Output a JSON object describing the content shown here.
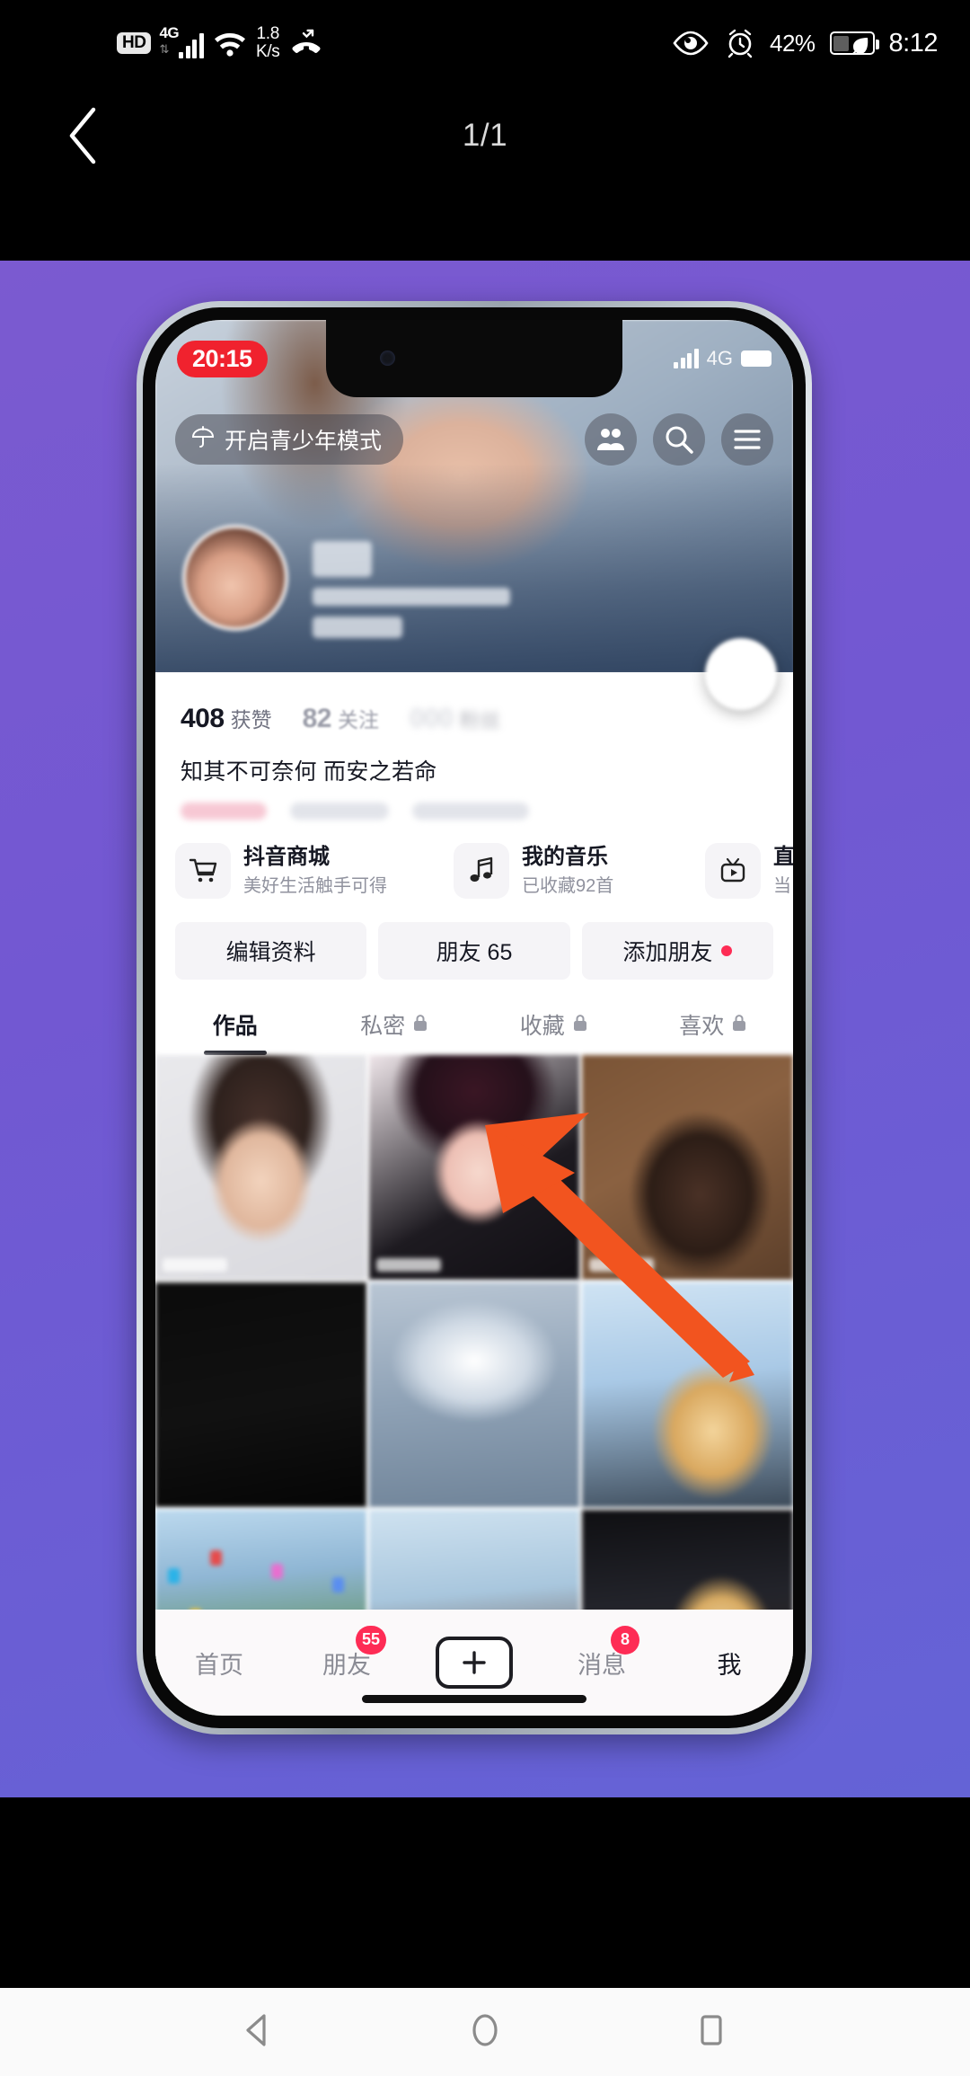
{
  "system_status_bar": {
    "hd_label": "HD",
    "network_type": "4G",
    "network_speed": "1.8",
    "network_speed_unit": "K/s",
    "battery_percent": "42%",
    "clock": "8:12",
    "icons": [
      "hd-icon",
      "signal-4g-icon",
      "wifi-icon",
      "missed-call-icon",
      "eye-comfort-icon",
      "alarm-icon",
      "battery-saver-icon"
    ]
  },
  "viewer_header": {
    "back_label": "back",
    "pager": "1/1"
  },
  "canvas": {
    "background_color": "#7258d2"
  },
  "phone_mock": {
    "app_status_bar": {
      "time": "20:15",
      "network_type": "4G"
    },
    "top_bar": {
      "teen_mode_label": "开启青少年模式",
      "icons": [
        "umbrella-icon",
        "friends-icon",
        "search-icon",
        "menu-icon"
      ]
    },
    "profile": {
      "stats": [
        {
          "number": "408",
          "label": "获赞",
          "style": "normal"
        },
        {
          "number": "82",
          "label": "关注",
          "style": "dim"
        },
        {
          "number": "",
          "label": "粉丝",
          "style": "hidden"
        }
      ],
      "bio": "知其不可奈何 而安之若命",
      "avatar_name": "avatar"
    },
    "shortcuts": [
      {
        "icon": "cart-icon",
        "title": "抖音商城",
        "subtitle": "美好生活触手可得"
      },
      {
        "icon": "music-note-icon",
        "title": "我的音乐",
        "subtitle": "已收藏92首"
      },
      {
        "icon": "tv-play-icon",
        "title": "直",
        "subtitle": "当"
      }
    ],
    "actions": [
      {
        "label": "编辑资料",
        "dot": false
      },
      {
        "label": "朋友 65",
        "dot": false
      },
      {
        "label": "添加朋友",
        "dot": true
      }
    ],
    "content_tabs": [
      {
        "label": "作品",
        "locked": false,
        "active": true
      },
      {
        "label": "私密",
        "locked": true,
        "active": false
      },
      {
        "label": "收藏",
        "locked": true,
        "active": false
      },
      {
        "label": "喜欢",
        "locked": true,
        "active": false
      }
    ],
    "grid_cells": [
      {
        "name": "thumb-1"
      },
      {
        "name": "thumb-2"
      },
      {
        "name": "thumb-3"
      },
      {
        "name": "thumb-4"
      },
      {
        "name": "thumb-5"
      },
      {
        "name": "thumb-6"
      },
      {
        "name": "thumb-7"
      },
      {
        "name": "thumb-8"
      },
      {
        "name": "thumb-9"
      }
    ],
    "bottom_nav": [
      {
        "label": "首页",
        "badge": "",
        "active": false
      },
      {
        "label": "朋友",
        "badge": "55",
        "active": false
      },
      {
        "label": "",
        "badge": "",
        "active": false,
        "is_plus": true
      },
      {
        "label": "消息",
        "badge": "8",
        "active": false
      },
      {
        "label": "我",
        "badge": "",
        "active": true
      }
    ]
  },
  "annotation": {
    "arrow_color": "#f2541f",
    "arrow_name": "pointer-arrow"
  },
  "android_nav": {
    "back": "back-triangle-icon",
    "home": "home-circle-icon",
    "recents": "recents-square-icon"
  },
  "colors": {
    "accent_red": "#fe2c55",
    "purple_bg": "#7258d2",
    "arrow_orange": "#f2541f"
  }
}
